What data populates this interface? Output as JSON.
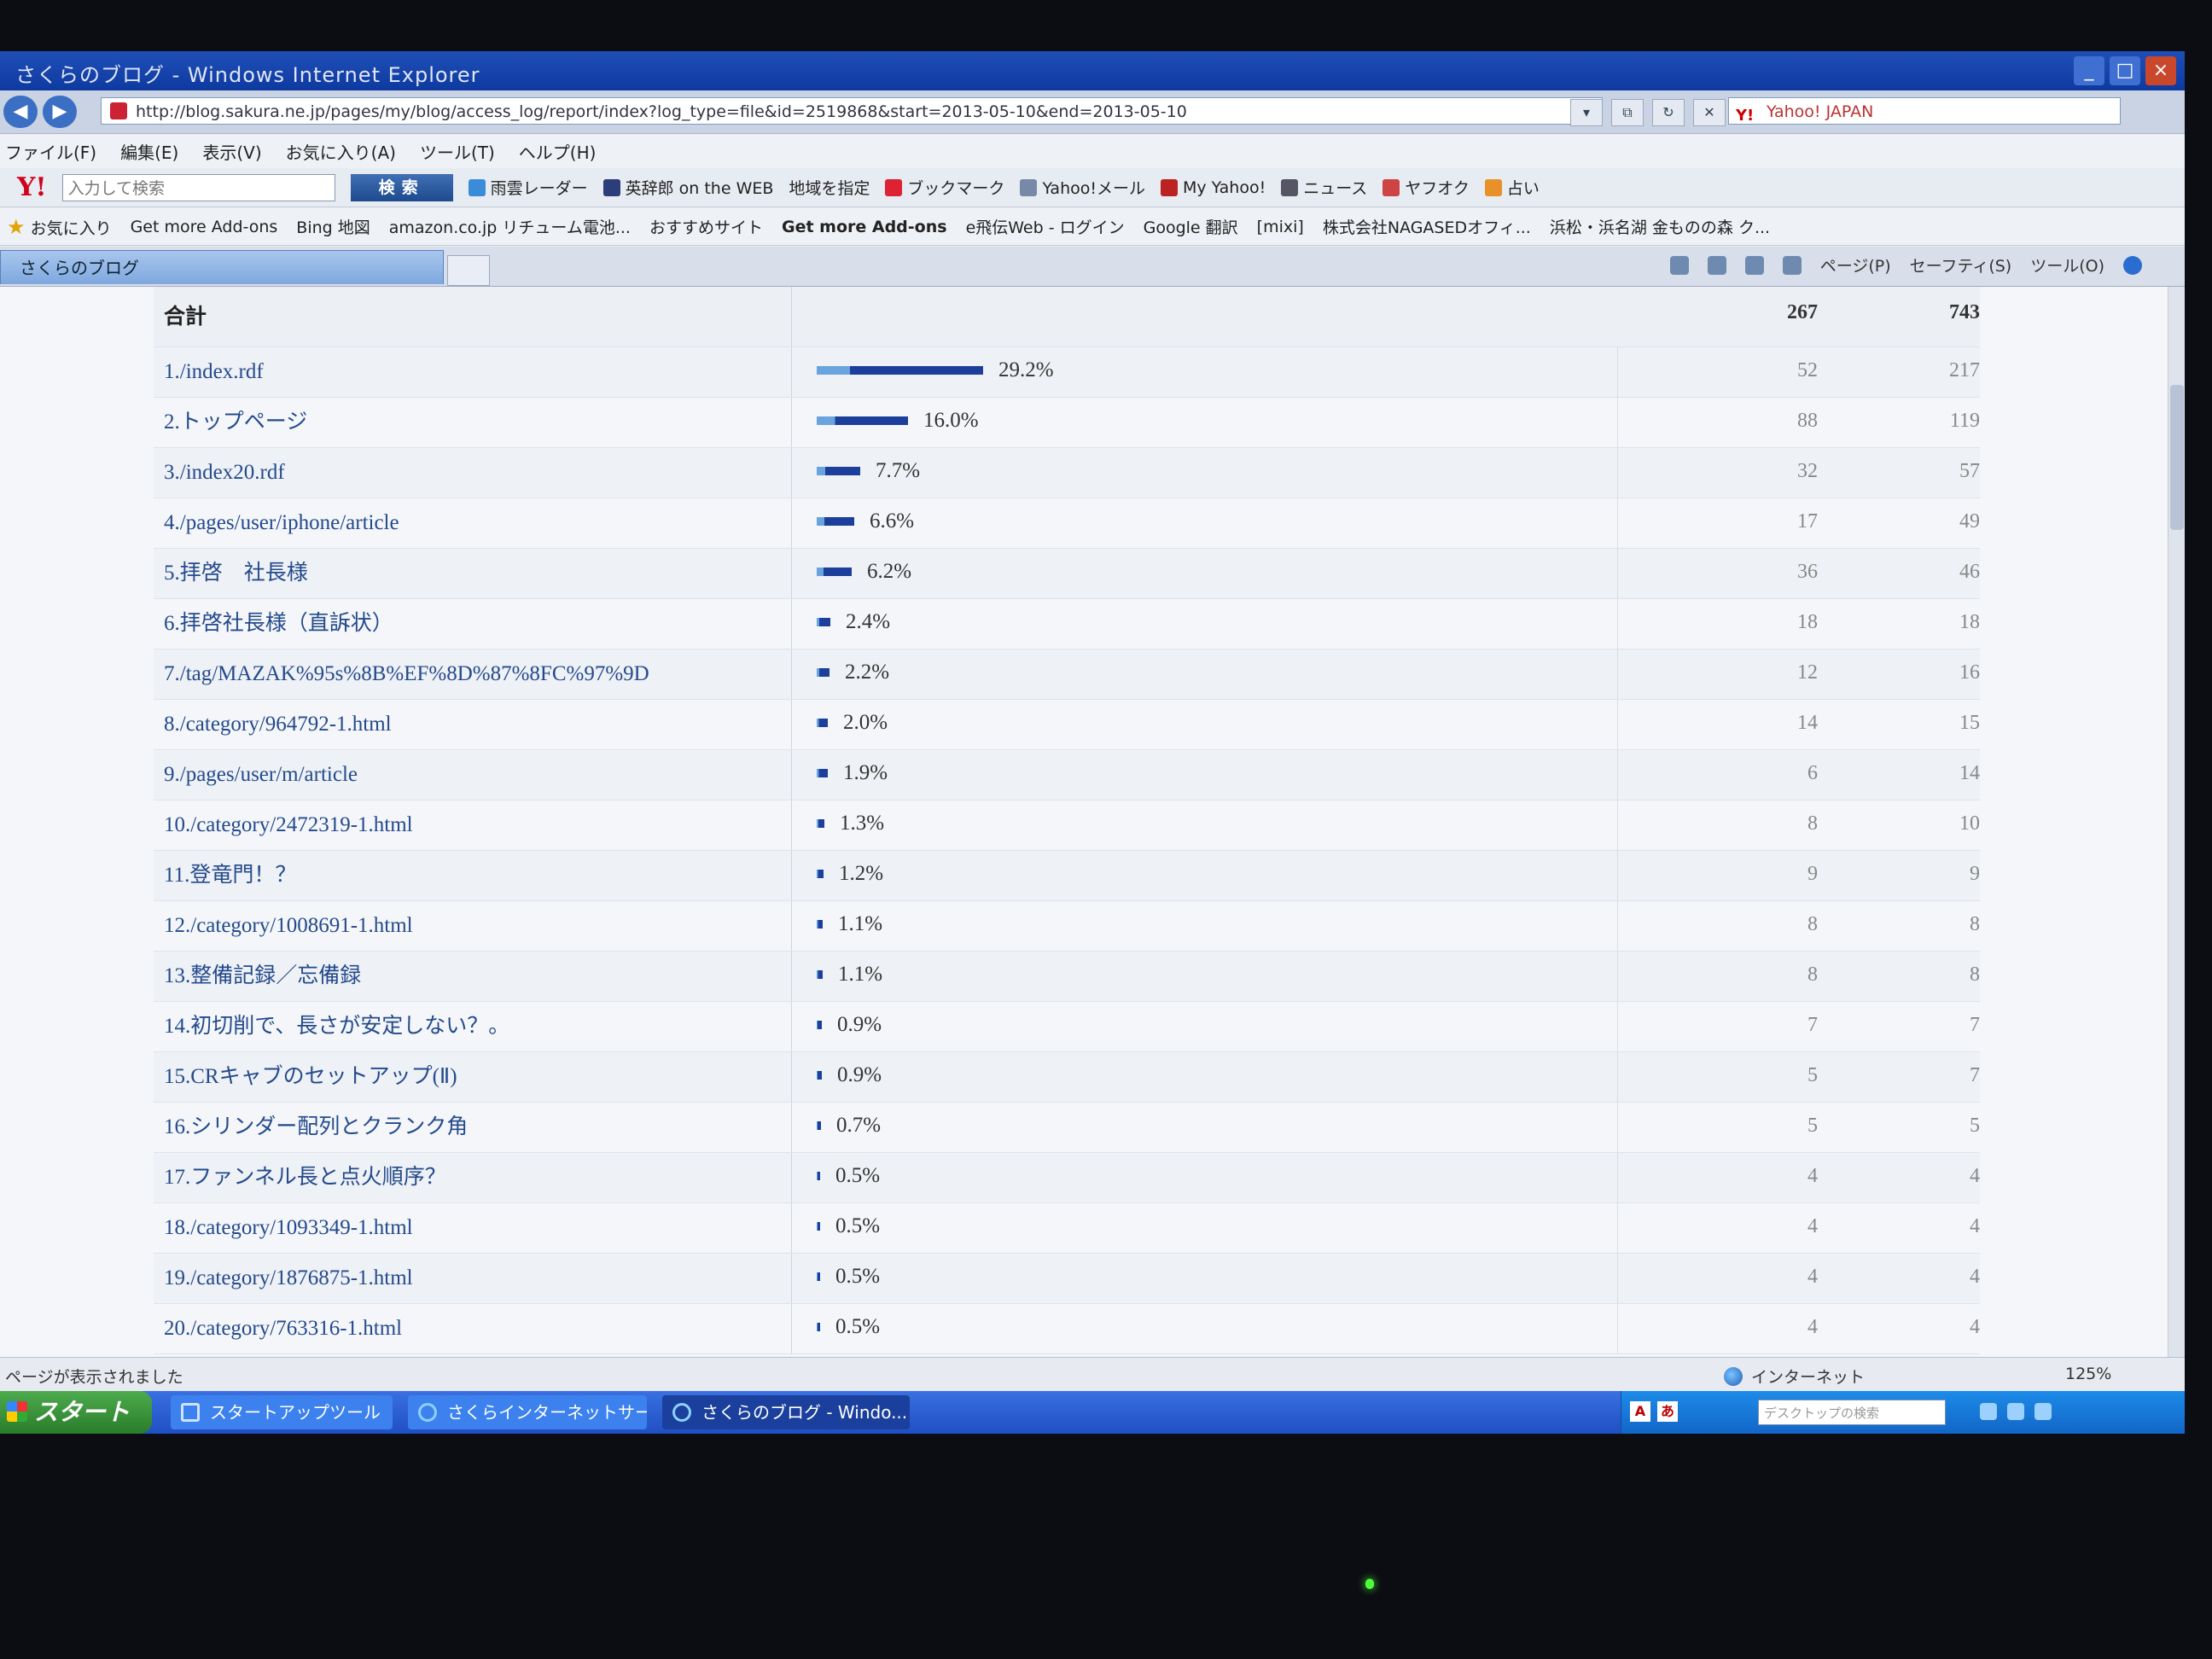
{
  "window": {
    "title": "さくらのブログ - Windows Internet Explorer"
  },
  "addressbar": {
    "url": "http://blog.sakura.ne.jp/pages/my/blog/access_log/report/index?log_type=file&id=2519868&start=2013-05-10&end=2013-05-10",
    "search_provider": "Yahoo! JAPAN"
  },
  "menu": [
    "ファイル(F)",
    "編集(E)",
    "表示(V)",
    "お気に入り(A)",
    "ツール(T)",
    "ヘルプ(H)"
  ],
  "yahoo_toolbar": {
    "logo": "Y!",
    "placeholder": "入力して検索",
    "search_button": "検索",
    "items": [
      "雨雲レーダー",
      "英辞郎 on the WEB",
      "地域を指定",
      "ブックマーク",
      "Yahoo!メール",
      "My Yahoo!",
      "ニュース",
      "ヤフオク",
      "占い"
    ]
  },
  "favorites_bar": {
    "label": "お気に入り",
    "items": [
      "Get more Add-ons",
      "Bing 地図",
      "amazon.co.jp リチューム電池...",
      "おすすめサイト",
      "Get more Add-ons",
      "e飛伝Web - ログイン",
      "Google 翻訳",
      "[mixi]",
      "株式会社NAGASEDオフィ...",
      "浜松・浜名湖 金ものの森 ク..."
    ]
  },
  "tabs": {
    "active": "さくらのブログ",
    "command_items": [
      "ページ(P)",
      "セーフティ(S)",
      "ツール(O)"
    ]
  },
  "report": {
    "header": {
      "label": "合計",
      "col_a": "267",
      "col_b": "743"
    },
    "rows": [
      {
        "name": "1./index.rdf",
        "pct": "29.2%",
        "pct_value": 29.2,
        "a": "52",
        "b": "217"
      },
      {
        "name": "2.トップページ",
        "pct": "16.0%",
        "pct_value": 16.0,
        "a": "88",
        "b": "119"
      },
      {
        "name": "3./index20.rdf",
        "pct": "7.7%",
        "pct_value": 7.7,
        "a": "32",
        "b": "57"
      },
      {
        "name": "4./pages/user/iphone/article",
        "pct": "6.6%",
        "pct_value": 6.6,
        "a": "17",
        "b": "49"
      },
      {
        "name": "5.拝啓　社長様",
        "pct": "6.2%",
        "pct_value": 6.2,
        "a": "36",
        "b": "46"
      },
      {
        "name": "6.拝啓社長様（直訴状）",
        "pct": "2.4%",
        "pct_value": 2.4,
        "a": "18",
        "b": "18"
      },
      {
        "name": "7./tag/MAZAK%95s%8B%EF%8D%87%8FC%97%9D",
        "pct": "2.2%",
        "pct_value": 2.2,
        "a": "12",
        "b": "16"
      },
      {
        "name": "8./category/964792-1.html",
        "pct": "2.0%",
        "pct_value": 2.0,
        "a": "14",
        "b": "15"
      },
      {
        "name": "9./pages/user/m/article",
        "pct": "1.9%",
        "pct_value": 1.9,
        "a": "6",
        "b": "14"
      },
      {
        "name": "10./category/2472319-1.html",
        "pct": "1.3%",
        "pct_value": 1.3,
        "a": "8",
        "b": "10"
      },
      {
        "name": "11.登竜門！？",
        "pct": "1.2%",
        "pct_value": 1.2,
        "a": "9",
        "b": "9"
      },
      {
        "name": "12./category/1008691-1.html",
        "pct": "1.1%",
        "pct_value": 1.1,
        "a": "8",
        "b": "8"
      },
      {
        "name": "13.整備記録／忘備録",
        "pct": "1.1%",
        "pct_value": 1.1,
        "a": "8",
        "b": "8"
      },
      {
        "name": "14.初切削で、長さが安定しない？。",
        "pct": "0.9%",
        "pct_value": 0.9,
        "a": "7",
        "b": "7"
      },
      {
        "name": "15.CRキャブのセットアップ(Ⅱ)",
        "pct": "0.9%",
        "pct_value": 0.9,
        "a": "5",
        "b": "7"
      },
      {
        "name": "16.シリンダー配列とクランク角",
        "pct": "0.7%",
        "pct_value": 0.7,
        "a": "5",
        "b": "5"
      },
      {
        "name": "17.ファンネル長と点火順序？",
        "pct": "0.5%",
        "pct_value": 0.5,
        "a": "4",
        "b": "4"
      },
      {
        "name": "18./category/1093349-1.html",
        "pct": "0.5%",
        "pct_value": 0.5,
        "a": "4",
        "b": "4"
      },
      {
        "name": "19./category/1876875-1.html",
        "pct": "0.5%",
        "pct_value": 0.5,
        "a": "4",
        "b": "4"
      },
      {
        "name": "20./category/763316-1.html",
        "pct": "0.5%",
        "pct_value": 0.5,
        "a": "4",
        "b": "4"
      }
    ]
  },
  "statusbar": {
    "message": "ページが表示されました",
    "zone": "インターネット",
    "zoom": "125%"
  },
  "taskbar": {
    "start": "スタート",
    "tasks": [
      "スタートアップツール",
      "さくらインターネットサー...",
      "さくらのブログ - Windo..."
    ],
    "search_placeholder": "デスクトップの検索"
  }
}
